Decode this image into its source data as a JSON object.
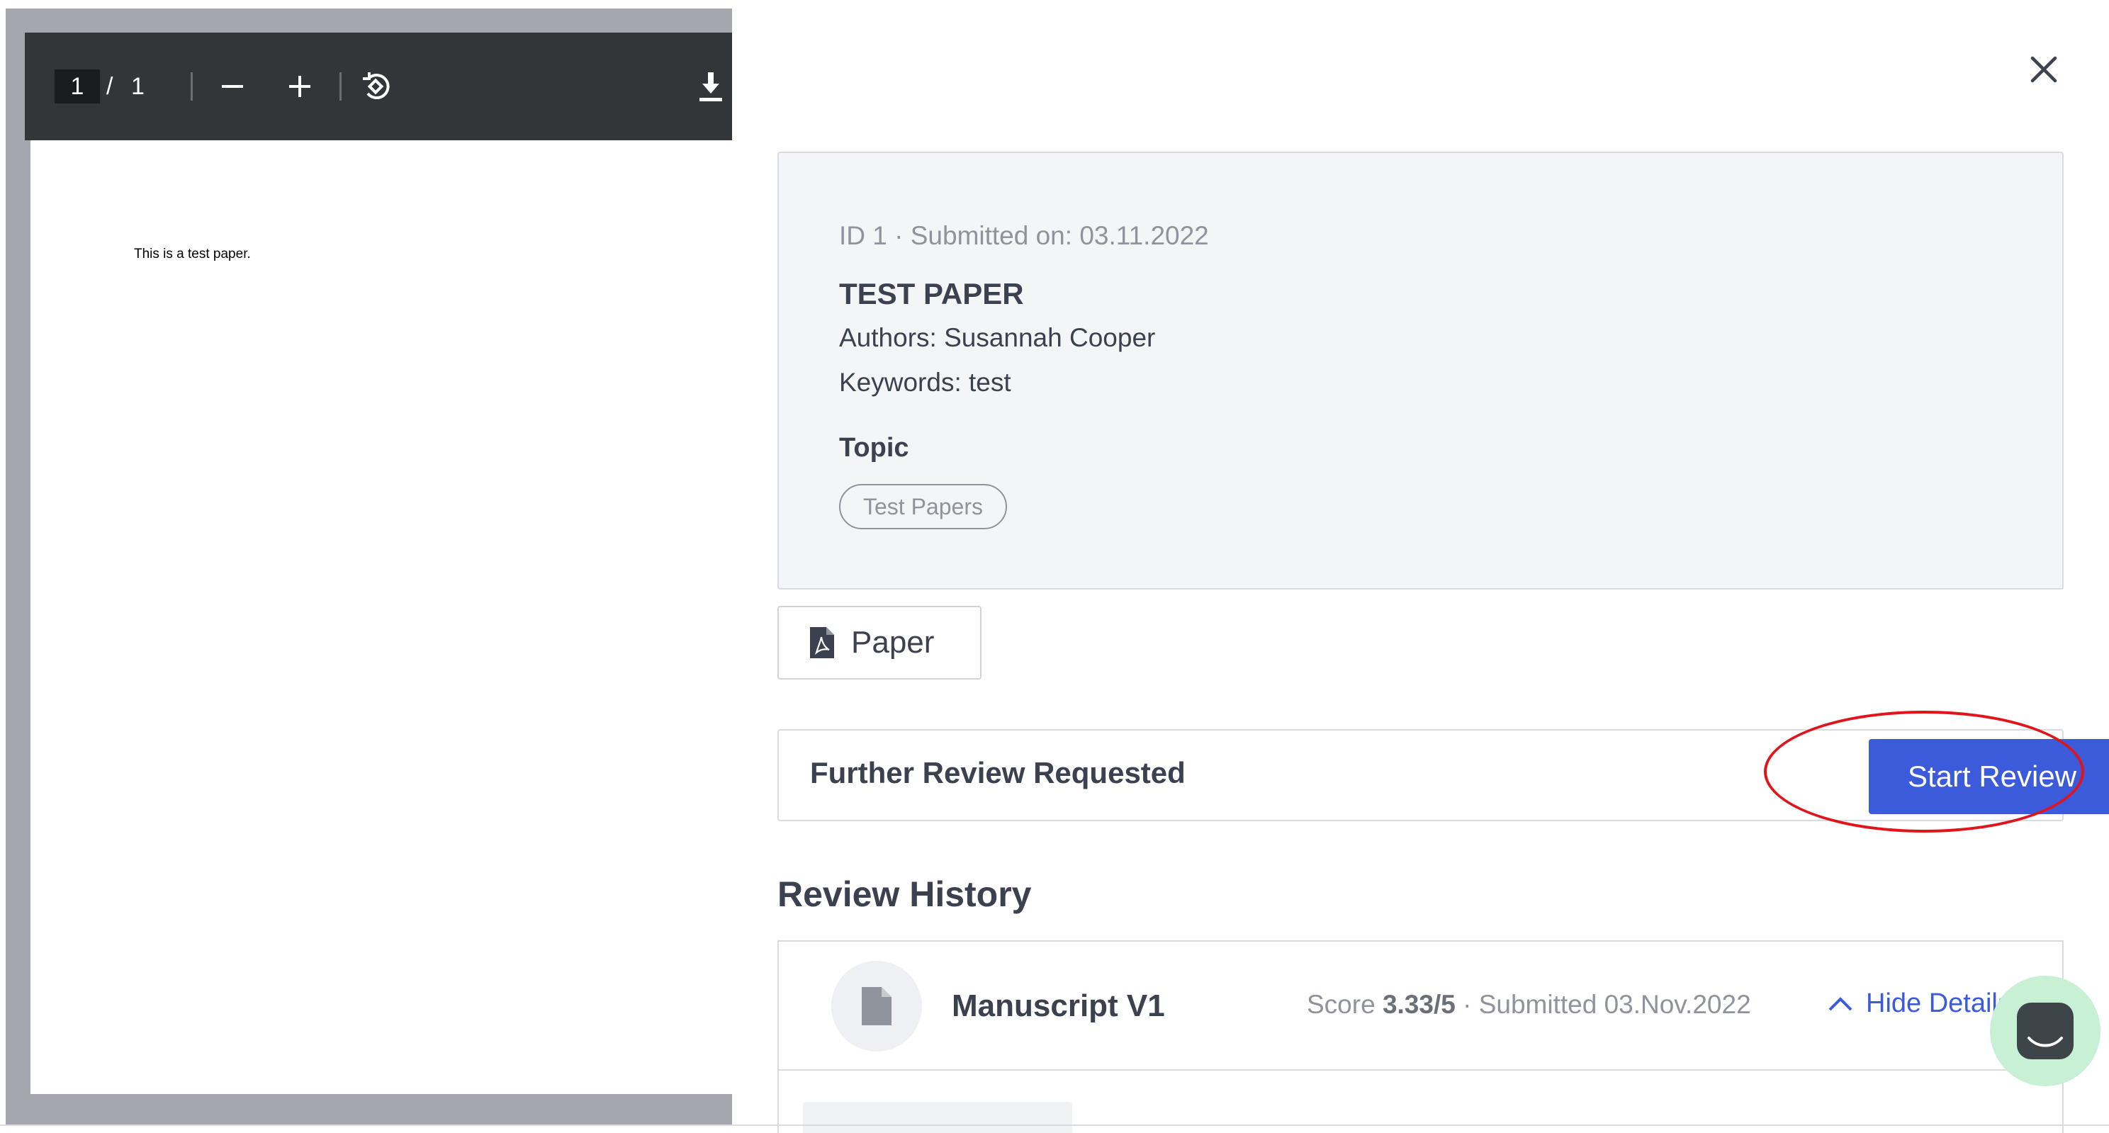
{
  "pdf_viewer": {
    "current_page": "1",
    "page_separator": "/",
    "total_pages": "1",
    "content_text": "This is a test paper."
  },
  "paper": {
    "meta": "ID 1 · Submitted on: 03.11.2022",
    "title": "TEST PAPER",
    "authors": "Authors: Susannah Cooper",
    "keywords": "Keywords: test",
    "topic_label": "Topic",
    "topic_tag": "Test Papers"
  },
  "file_button": {
    "label": "Paper"
  },
  "review": {
    "status": "Further Review Requested",
    "start_button": "Start Review"
  },
  "history": {
    "heading": "Review History",
    "items": [
      {
        "title": "Manuscript V1",
        "score_prefix": "Score",
        "score": "3.33/5",
        "submitted": " · Submitted 03.Nov.2022",
        "toggle_label": "Hide Details"
      }
    ]
  },
  "colors": {
    "accent": "#3b5bdb",
    "annotation": "#e0141a",
    "card_bg": "#f4f5f7",
    "toolbar_bg": "#323639"
  }
}
